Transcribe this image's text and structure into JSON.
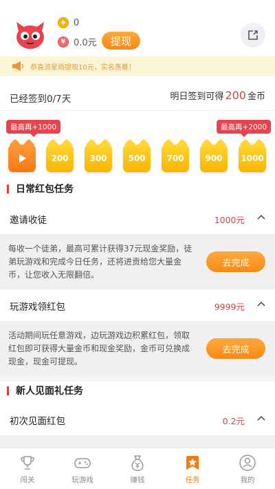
{
  "header": {
    "gold_coins": "0",
    "cash": "0.0元",
    "withdraw_label": "提现"
  },
  "notice": {
    "text": "恭喜流星雨提现10元，实名羡慕！"
  },
  "checkin": {
    "status": "已经签到0/7天",
    "tomorrow_prefix": "明日签到可得",
    "tomorrow_amount": "200",
    "tomorrow_suffix": "金币",
    "badge_left": "最高再+1000",
    "badge_right": "最高再+2000",
    "days": [
      "",
      "200",
      "300",
      "500",
      "700",
      "900",
      "1000"
    ]
  },
  "sections": {
    "daily_title": "日常红包任务",
    "newbie_title": "新人见面礼任务"
  },
  "tasks": [
    {
      "name": "邀请收徒",
      "reward": "1000元",
      "desc": "每收一个徒弟，最高可累计获得37元现金奖励，徒弟玩游戏和完成今日任务，还将进贡给您大量金币，让您收入无限翻倍。",
      "button": "去完成"
    },
    {
      "name": "玩游戏领红包",
      "reward": "9999元",
      "desc": "活动期间玩任意游戏，边玩游戏边积累红包，领取红包即可获得大量金币和现金奖励，金币可兑换成现金，现金可提现。",
      "button": "去完成"
    },
    {
      "name": "初次见面红包",
      "reward": "0.2元"
    }
  ],
  "tabbar": {
    "items": [
      {
        "label": "闯关",
        "icon": "trophy-icon"
      },
      {
        "label": "玩游戏",
        "icon": "gamepad-icon"
      },
      {
        "label": "赚钱",
        "icon": "money-bag-icon"
      },
      {
        "label": "任务",
        "icon": "star-icon"
      },
      {
        "label": "我的",
        "icon": "user-icon"
      }
    ],
    "active_index": 3
  },
  "colors": {
    "accent": "#f68a16",
    "reward_red": "#e23d3d",
    "notice_bg": "#fdf4d6"
  }
}
